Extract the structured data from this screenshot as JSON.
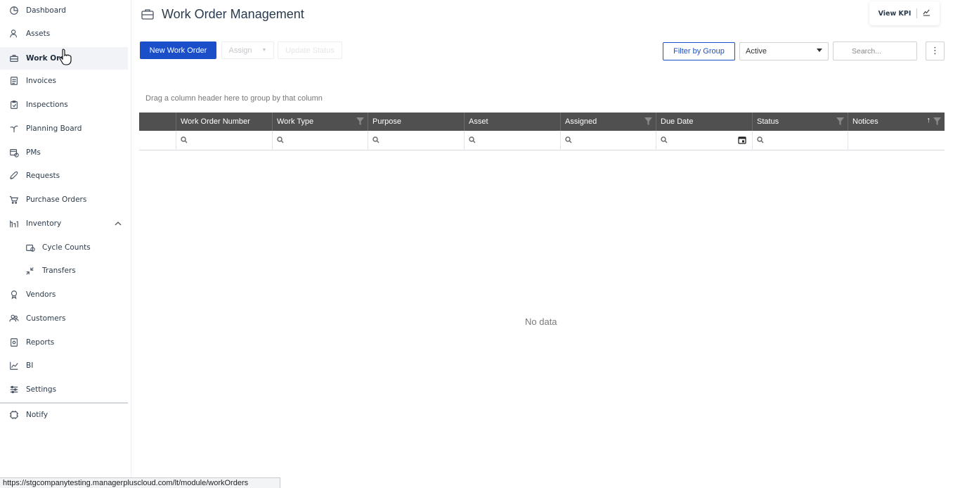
{
  "sidebar": {
    "items": [
      {
        "label": "Dashboard",
        "icon": "dashboard-icon"
      },
      {
        "label": "Assets",
        "icon": "assets-icon"
      },
      {
        "label": "Work Orde",
        "icon": "briefcase-icon"
      },
      {
        "label": "Invoices",
        "icon": "invoice-icon"
      },
      {
        "label": "Inspections",
        "icon": "clipboard-icon"
      },
      {
        "label": "Planning Board",
        "icon": "planning-icon"
      },
      {
        "label": "PMs",
        "icon": "pm-icon"
      },
      {
        "label": "Requests",
        "icon": "rocket-icon"
      },
      {
        "label": "Purchase Orders",
        "icon": "cart-icon"
      },
      {
        "label": "Inventory",
        "icon": "inventory-icon"
      },
      {
        "label": "Cycle Counts",
        "icon": "cycle-icon"
      },
      {
        "label": "Transfers",
        "icon": "transfer-icon"
      },
      {
        "label": "Vendors",
        "icon": "vendor-icon"
      },
      {
        "label": "Customers",
        "icon": "customers-icon"
      },
      {
        "label": "Reports",
        "icon": "reports-icon"
      },
      {
        "label": "BI",
        "icon": "bi-icon"
      },
      {
        "label": "Settings",
        "icon": "settings-icon"
      },
      {
        "label": "Notify",
        "icon": "notify-icon"
      }
    ]
  },
  "header": {
    "title": "Work Order Management",
    "kpi_label": "View KPI"
  },
  "toolbar": {
    "new_label": "New Work Order",
    "assign_label": "Assign",
    "update_label": "Update Status",
    "filter_group_label": "Filter by Group",
    "status_select": "Active",
    "search_placeholder": "Search...",
    "kebab": "⋮"
  },
  "grid": {
    "group_hint": "Drag a column header here to group by that column",
    "columns": [
      "Work Order Number",
      "Work Type",
      "Purpose",
      "Asset",
      "Assigned",
      "Due Date",
      "Status",
      "Notices"
    ],
    "empty_text": "No data"
  },
  "status_bar": {
    "url": "https://stgcompanytesting.managerpluscloud.com/lt/module/workOrders"
  },
  "colors": {
    "primary": "#1b4fc9",
    "grid_header": "#505050"
  }
}
